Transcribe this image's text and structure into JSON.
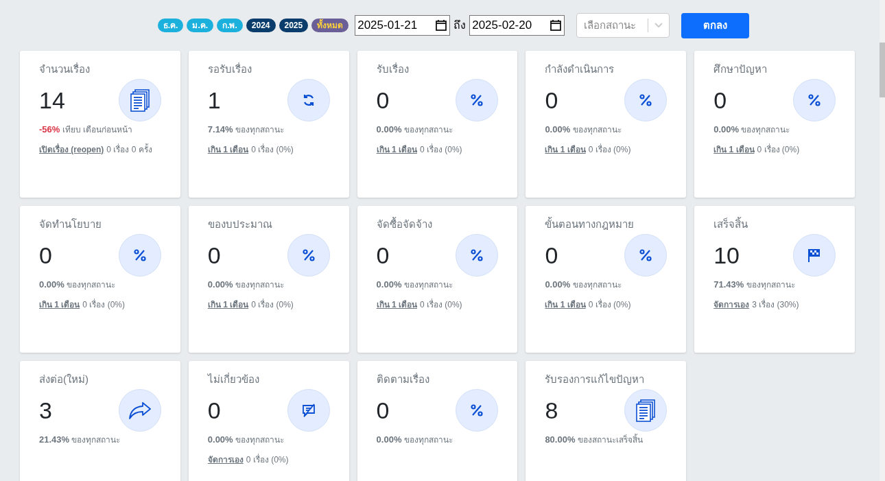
{
  "filters": {
    "chips": [
      {
        "label": "ธ.ค.",
        "kind": "month"
      },
      {
        "label": "ม.ค.",
        "kind": "month"
      },
      {
        "label": "ก.พ.",
        "kind": "month"
      },
      {
        "label": "2024",
        "kind": "year"
      },
      {
        "label": "2025",
        "kind": "year"
      },
      {
        "label": "ทั้งหมด",
        "kind": "all"
      }
    ],
    "date_from": "2025-01-21",
    "to_label": "ถึง",
    "date_to": "2025-02-20",
    "status_select": {
      "placeholder": "เลือกสถานะ"
    },
    "submit": "ตกลง"
  },
  "cards": [
    {
      "title": "จำนวนเรื่อง",
      "value": "14",
      "kind": "documents",
      "percent": "-56%",
      "color": "#dc3545",
      "note": "เทียบ เดือนก่อนหน้า",
      "link": "เปิดเรื่อง (reopen)",
      "link_note": "0 เรื่อง 0 ครั้ง"
    },
    {
      "title": "รอรับเรื่อง",
      "value": "1",
      "kind": "refresh",
      "percent": "7.14%",
      "color": "#6c757d",
      "note": "ของทุกสถานะ",
      "link": "เกิน 1 เดือน",
      "link_note": "0 เรื่อง (0%)"
    },
    {
      "title": "รับเรื่อง",
      "value": "0",
      "kind": "percent",
      "percent": "0.00%",
      "color": "#6c757d",
      "note": "ของทุกสถานะ",
      "link": "เกิน 1 เดือน",
      "link_note": "0 เรื่อง (0%)"
    },
    {
      "title": "กำลังดำเนินการ",
      "value": "0",
      "kind": "percent",
      "percent": "0.00%",
      "color": "#6c757d",
      "note": "ของทุกสถานะ",
      "link": "เกิน 1 เดือน",
      "link_note": "0 เรื่อง (0%)"
    },
    {
      "title": "ศึกษาปัญหา",
      "value": "0",
      "kind": "percent",
      "percent": "0.00%",
      "color": "#6c757d",
      "note": "ของทุกสถานะ",
      "link": "เกิน 1 เดือน",
      "link_note": "0 เรื่อง (0%)"
    },
    {
      "title": "จัดทำนโยบาย",
      "value": "0",
      "kind": "percent",
      "percent": "0.00%",
      "color": "#6c757d",
      "note": "ของทุกสถานะ",
      "link": "เกิน 1 เดือน",
      "link_note": "0 เรื่อง (0%)"
    },
    {
      "title": "ของบประมาณ",
      "value": "0",
      "kind": "percent",
      "percent": "0.00%",
      "color": "#6c757d",
      "note": "ของทุกสถานะ",
      "link": "เกิน 1 เดือน",
      "link_note": "0 เรื่อง (0%)"
    },
    {
      "title": "จัดซื้อจัดจ้าง",
      "value": "0",
      "kind": "percent",
      "percent": "0.00%",
      "color": "#6c757d",
      "note": "ของทุกสถานะ",
      "link": "เกิน 1 เดือน",
      "link_note": "0 เรื่อง (0%)"
    },
    {
      "title": "ขั้นตอนทางกฎหมาย",
      "value": "0",
      "kind": "percent",
      "percent": "0.00%",
      "color": "#6c757d",
      "note": "ของทุกสถานะ",
      "link": "เกิน 1 เดือน",
      "link_note": "0 เรื่อง (0%)"
    },
    {
      "title": "เสร็จสิ้น",
      "value": "10",
      "kind": "flag",
      "percent": "71.43%",
      "color": "#6c757d",
      "note": "ของทุกสถานะ",
      "link": "จัดการเอง",
      "link_note": "3 เรื่อง (30%)"
    },
    {
      "title": "ส่งต่อ(ใหม่)",
      "value": "3",
      "kind": "share",
      "percent": "21.43%",
      "color": "#6c757d",
      "note": "ของทุกสถานะ"
    },
    {
      "title": "ไม่เกี่ยวข้อง",
      "value": "0",
      "kind": "chat-off",
      "percent": "0.00%",
      "color": "#6c757d",
      "note": "ของทุกสถานะ",
      "link": "จัดการเอง",
      "link_note": "0 เรื่อง (0%)"
    },
    {
      "title": "ติดตามเรื่อง",
      "value": "0",
      "kind": "percent",
      "percent": "0.00%",
      "color": "#6c757d",
      "note": "ของทุกสถานะ"
    },
    {
      "title": "รับรองการแก้ไขปัญหา",
      "value": "8",
      "kind": "documents",
      "percent": "80.00%",
      "color": "#6c757d",
      "note": "ของสถานะเสร็จสิ้น"
    }
  ]
}
